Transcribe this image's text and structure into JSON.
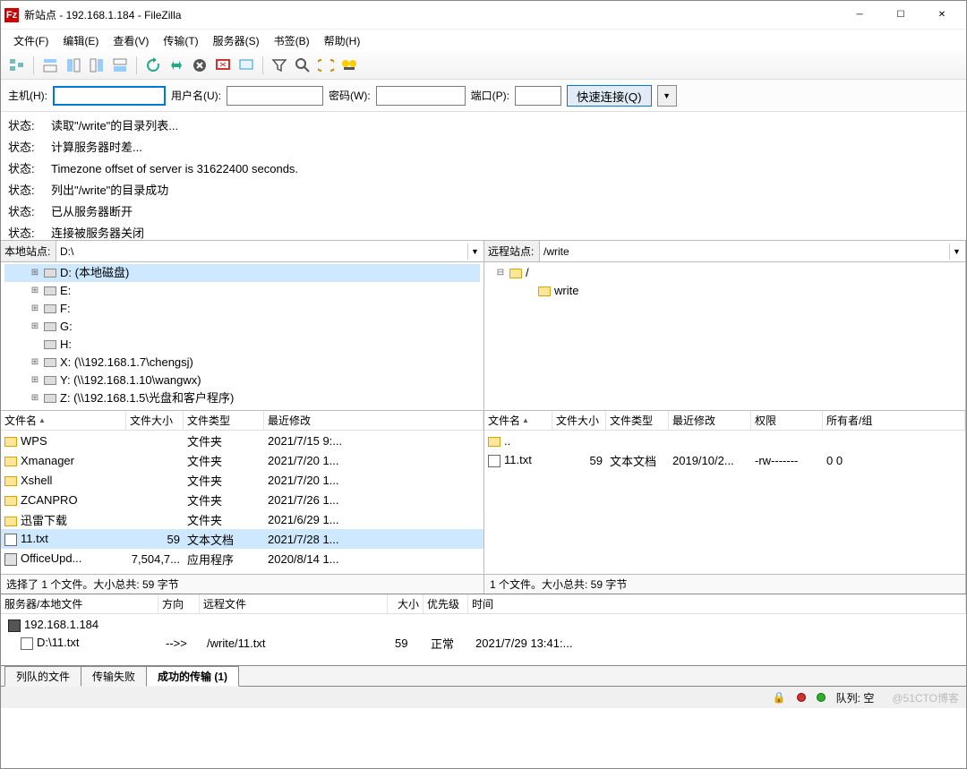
{
  "title": "新站点 - 192.168.1.184 - FileZilla",
  "menus": [
    "文件(F)",
    "编辑(E)",
    "查看(V)",
    "传输(T)",
    "服务器(S)",
    "书签(B)",
    "帮助(H)"
  ],
  "quick": {
    "host_label": "主机(H):",
    "user_label": "用户名(U):",
    "pass_label": "密码(W):",
    "port_label": "端口(P):",
    "connect": "快速连接(Q)"
  },
  "log": [
    {
      "s": "状态:",
      "t": "读取\"/write\"的目录列表..."
    },
    {
      "s": "状态:",
      "t": "计算服务器时差..."
    },
    {
      "s": "状态:",
      "t": "Timezone offset of server is 31622400 seconds."
    },
    {
      "s": "状态:",
      "t": "列出\"/write\"的目录成功"
    },
    {
      "s": "状态:",
      "t": "已从服务器断开"
    },
    {
      "s": "状态:",
      "t": "连接被服务器关闭"
    }
  ],
  "local": {
    "site_label": "本地站点:",
    "path": "D:\\",
    "tree": [
      {
        "indent": 28,
        "toggle": "⊞",
        "icon": "drive",
        "label": "D: (本地磁盘)",
        "sel": true
      },
      {
        "indent": 28,
        "toggle": "⊞",
        "icon": "drive",
        "label": "E:"
      },
      {
        "indent": 28,
        "toggle": "⊞",
        "icon": "drive",
        "label": "F:"
      },
      {
        "indent": 28,
        "toggle": "⊞",
        "icon": "drive",
        "label": "G:"
      },
      {
        "indent": 28,
        "toggle": "",
        "icon": "drive",
        "label": "H:"
      },
      {
        "indent": 28,
        "toggle": "⊞",
        "icon": "drive",
        "label": "X: (\\\\192.168.1.7\\chengsj)"
      },
      {
        "indent": 28,
        "toggle": "⊞",
        "icon": "drive",
        "label": "Y: (\\\\192.168.1.10\\wangwx)"
      },
      {
        "indent": 28,
        "toggle": "⊞",
        "icon": "drive",
        "label": "Z: (\\\\192.168.1.5\\光盘和客户程序)"
      }
    ],
    "cols": {
      "name": "文件名",
      "size": "文件大小",
      "type": "文件类型",
      "mod": "最近修改"
    },
    "rows": [
      {
        "name": "WPS",
        "size": "",
        "type": "文件夹",
        "mod": "2021/7/15 9:...",
        "icon": "folder"
      },
      {
        "name": "Xmanager",
        "size": "",
        "type": "文件夹",
        "mod": "2021/7/20 1...",
        "icon": "folder"
      },
      {
        "name": "Xshell",
        "size": "",
        "type": "文件夹",
        "mod": "2021/7/20 1...",
        "icon": "folder"
      },
      {
        "name": "ZCANPRO",
        "size": "",
        "type": "文件夹",
        "mod": "2021/7/26 1...",
        "icon": "folder"
      },
      {
        "name": "迅雷下载",
        "size": "",
        "type": "文件夹",
        "mod": "2021/6/29 1...",
        "icon": "folder"
      },
      {
        "name": "11.txt",
        "size": "59",
        "type": "文本文档",
        "mod": "2021/7/28 1...",
        "icon": "txt",
        "sel": true
      },
      {
        "name": "OfficeUpd...",
        "size": "7,504,7...",
        "type": "应用程序",
        "mod": "2020/8/14 1...",
        "icon": "exe"
      }
    ],
    "status": "选择了 1 个文件。大小总共: 59 字节"
  },
  "remote": {
    "site_label": "远程站点:",
    "path": "/write",
    "tree": [
      {
        "indent": 8,
        "toggle": "⊟",
        "icon": "folder",
        "label": "/"
      },
      {
        "indent": 40,
        "toggle": "",
        "icon": "folder",
        "label": "write"
      }
    ],
    "cols": {
      "name": "文件名",
      "size": "文件大小",
      "type": "文件类型",
      "mod": "最近修改",
      "perm": "权限",
      "owner": "所有者/组"
    },
    "rows": [
      {
        "name": "..",
        "size": "",
        "type": "",
        "mod": "",
        "perm": "",
        "owner": "",
        "icon": "folder"
      },
      {
        "name": "11.txt",
        "size": "59",
        "type": "文本文档",
        "mod": "2019/10/2...",
        "perm": "-rw-------",
        "owner": "0 0",
        "icon": "txt"
      }
    ],
    "status": "1 个文件。大小总共: 59 字节"
  },
  "xfer": {
    "cols": {
      "name": "服务器/本地文件",
      "dir": "方向",
      "remote": "远程文件",
      "size": "大小",
      "prio": "优先级",
      "time": "时间"
    },
    "server": "192.168.1.184",
    "row": {
      "local": "D:\\11.txt",
      "dir": "-->>",
      "remote": "/write/11.txt",
      "size": "59",
      "prio": "正常",
      "time": "2021/7/29 13:41:..."
    }
  },
  "tabs": {
    "queued": "列队的文件",
    "failed": "传输失败",
    "success": "成功的传输 (1)"
  },
  "statusbar": {
    "queue": "队列: 空",
    "watermark": "@51CTO博客"
  }
}
